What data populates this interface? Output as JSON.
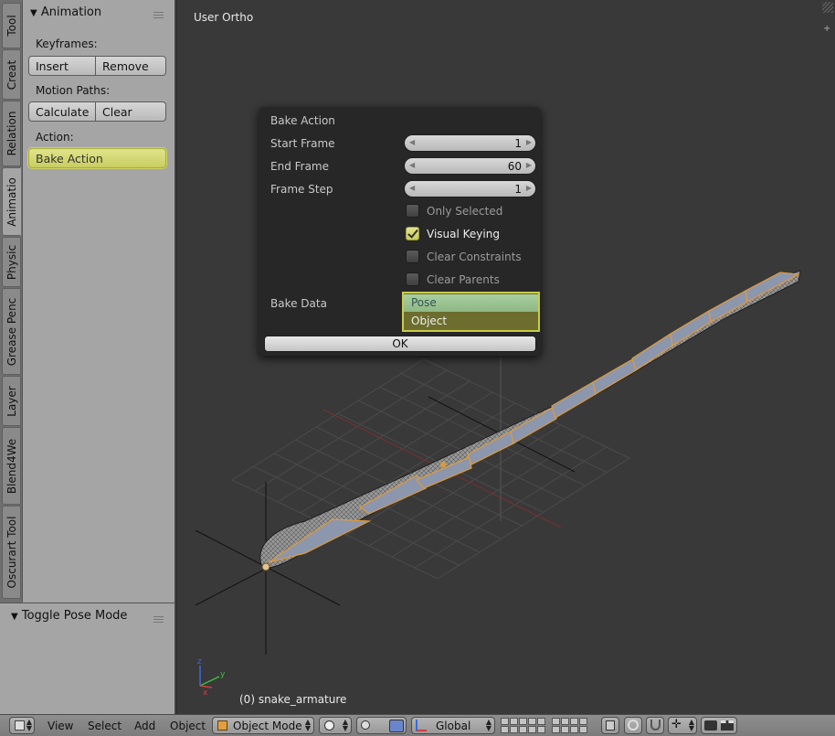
{
  "tabs": [
    "Tool",
    "Creat",
    "Relation",
    "Animatio",
    "Physic",
    "Grease Penc",
    "Layer",
    "Blend4We",
    "Oscurart Tool"
  ],
  "animation_panel": {
    "title": "Animation",
    "keyframes_label": "Keyframes:",
    "insert": "Insert",
    "remove": "Remove",
    "motion_paths_label": "Motion Paths:",
    "calculate": "Calculate",
    "clear": "Clear",
    "action_label": "Action:",
    "bake_action": "Bake Action"
  },
  "toggle_panel": {
    "title": "Toggle Pose Mode"
  },
  "viewport": {
    "view_name": "User Ortho",
    "object_info": "(0) snake_armature",
    "axis_x": "x",
    "axis_y": "y",
    "axis_z": "z"
  },
  "popup": {
    "title": "Bake Action",
    "start_frame_label": "Start Frame",
    "start_frame": "1",
    "end_frame_label": "End Frame",
    "end_frame": "60",
    "frame_step_label": "Frame Step",
    "frame_step": "1",
    "only_selected": "Only Selected",
    "visual_keying": "Visual Keying",
    "clear_constraints": "Clear Constraints",
    "clear_parents": "Clear Parents",
    "bake_data_label": "Bake Data",
    "bake_options": [
      "Pose",
      "Object"
    ],
    "ok": "OK"
  },
  "header": {
    "menus": [
      "View",
      "Select",
      "Add",
      "Object"
    ],
    "mode": "Object Mode",
    "orientation": "Global"
  },
  "colors": {
    "accent_yellow": "#c8cc5e",
    "panel_bg": "#a5a5a5",
    "viewport_bg": "#393939",
    "popup_bg": "#272727"
  }
}
